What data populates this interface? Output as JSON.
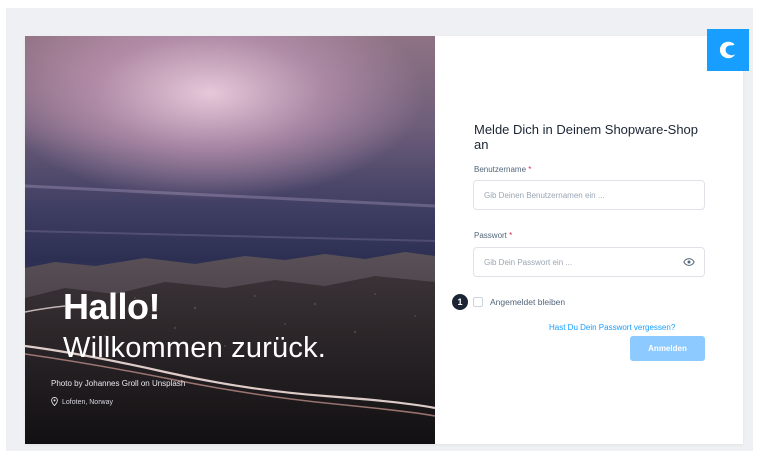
{
  "hero": {
    "greeting_title": "Hallo!",
    "greeting_subtitle": "Willkommen zurück.",
    "photo_credit": "Photo by Johannes Groll on Unsplash",
    "location": "Lofoten, Norway"
  },
  "brand": {
    "accent_color": "#189eff",
    "logo_icon": "shopware-logo-icon"
  },
  "login": {
    "title": "Melde Dich in Deinem Shopware-Shop an",
    "username": {
      "label": "Benutzername",
      "required_marker": "*",
      "placeholder": "Gib Deinen Benutzernamen ein ...",
      "value": ""
    },
    "password": {
      "label": "Passwort",
      "required_marker": "*",
      "placeholder": "Gib Dein Passwort ein ...",
      "value": "",
      "toggle_icon": "eye-icon"
    },
    "step_badge": "1",
    "remember_me": {
      "label": "Angemeldet bleiben",
      "checked": false
    },
    "forgot_password": "Hast Du Dein Passwort vergessen?",
    "submit_label": "Anmelden"
  }
}
